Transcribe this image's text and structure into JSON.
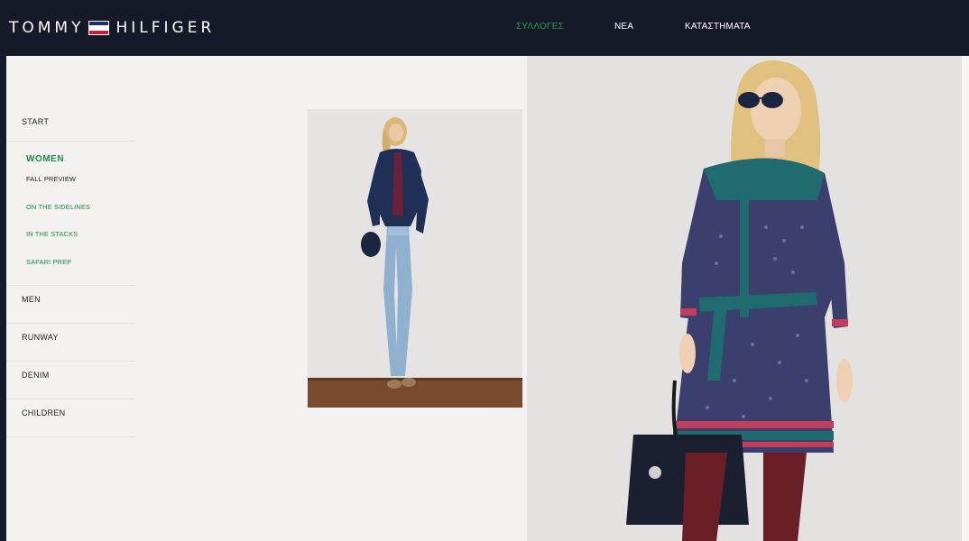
{
  "header": {
    "brand_left": "TOMMY",
    "brand_right": "HILFIGER",
    "nav": [
      "ΣΥΛΛΟΓΕΣ",
      "ΝΕΑ",
      "ΚΑΤΑΣΤΗΜΑΤΑ"
    ],
    "active_nav": "ΣΥΛΛΟΓΕΣ"
  },
  "sidebar": {
    "start": "START",
    "women": {
      "title": "WOMEN",
      "items": [
        "FALL PREVIEW",
        "ON THE SIDELINES",
        "IN THE STACKS",
        "SAFARI PREP"
      ]
    },
    "items": [
      "MEN",
      "RUNWAY",
      "DENIM",
      "CHILDREN"
    ]
  },
  "colors": {
    "header_bg": "#141a28",
    "accent_green": "#1f8a44",
    "page_bg": "#f3f2f1"
  }
}
